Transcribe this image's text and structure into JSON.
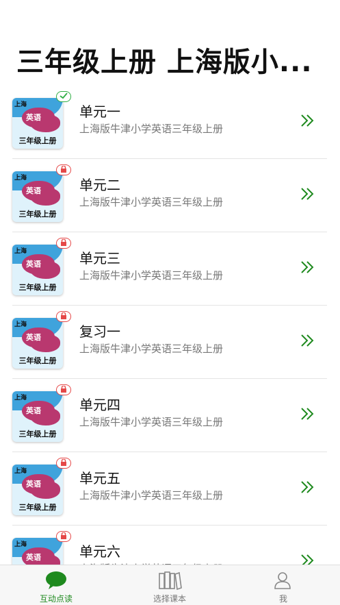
{
  "page": {
    "title": "三年级上册 上海版小..."
  },
  "thumbnail": {
    "region": "上海",
    "subject": "英语",
    "grade": "三年级上册"
  },
  "lessons": [
    {
      "title": "单元一",
      "subtitle": "上海版牛津小学英语三年级上册",
      "status": "unlocked"
    },
    {
      "title": "单元二",
      "subtitle": "上海版牛津小学英语三年级上册",
      "status": "locked"
    },
    {
      "title": "单元三",
      "subtitle": "上海版牛津小学英语三年级上册",
      "status": "locked"
    },
    {
      "title": "复习一",
      "subtitle": "上海版牛津小学英语三年级上册",
      "status": "locked"
    },
    {
      "title": "单元四",
      "subtitle": "上海版牛津小学英语三年级上册",
      "status": "locked"
    },
    {
      "title": "单元五",
      "subtitle": "上海版牛津小学英语三年级上册",
      "status": "locked"
    },
    {
      "title": "单元六",
      "subtitle": "上海版牛津小学英语三年级上册",
      "status": "locked"
    }
  ],
  "tabbar": {
    "tabs": [
      {
        "label": "互动点读",
        "icon": "chat-bubble-icon",
        "active": true
      },
      {
        "label": "选择课本",
        "icon": "books-icon",
        "active": false
      },
      {
        "label": "我",
        "icon": "person-icon",
        "active": false
      }
    ]
  },
  "colors": {
    "accent": "#1f8a1f",
    "locked": "#e54848",
    "unlocked": "#2fae45"
  }
}
